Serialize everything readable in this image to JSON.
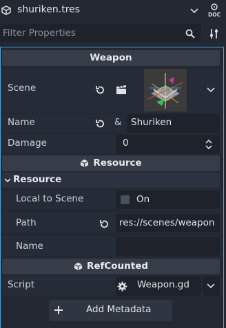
{
  "resource_bar": {
    "file_name": "shuriken.tres",
    "doc_label": "DOC"
  },
  "filter": {
    "placeholder": "Filter Properties"
  },
  "sections": {
    "weapon": {
      "title": "Weapon"
    },
    "resource": {
      "title": "Resource",
      "group_title": "Resource"
    },
    "refcounted": {
      "title": "RefCounted"
    }
  },
  "properties": {
    "scene": {
      "label": "Scene"
    },
    "name": {
      "label": "Name",
      "value": "Shuriken",
      "prefix": "&"
    },
    "damage": {
      "label": "Damage",
      "value": "0"
    },
    "local_to_scene": {
      "label": "Local to Scene",
      "value": "On",
      "checked": false
    },
    "path": {
      "label": "Path",
      "value": "res://scenes/weapon"
    },
    "resource_name": {
      "label": "Name",
      "value": ""
    },
    "script": {
      "label": "Script",
      "value": "Weapon.gd"
    }
  },
  "add_metadata": {
    "label": "Add Metadata"
  },
  "colors": {
    "accent": "#4aa3df",
    "panel": "#232833",
    "field": "#1d222b",
    "header": "#363c48"
  }
}
